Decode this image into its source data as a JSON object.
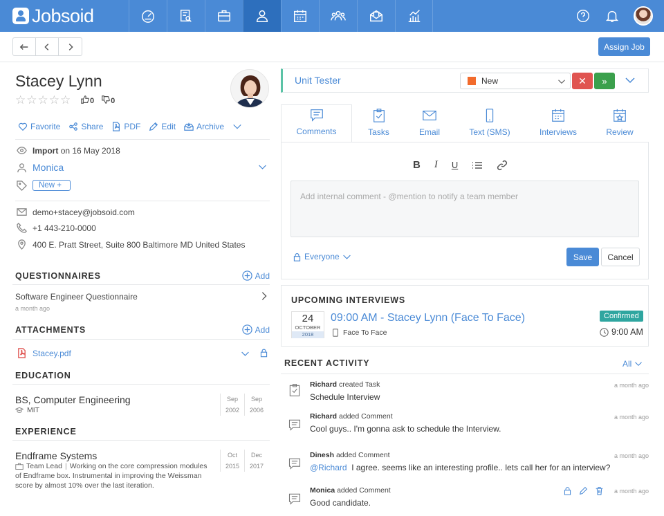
{
  "app": {
    "name": "Jobsoid"
  },
  "topnav": {
    "items": [
      {
        "icon": "dashboard-icon"
      },
      {
        "icon": "jobs-icon"
      },
      {
        "icon": "briefcase-icon"
      },
      {
        "icon": "candidates-icon",
        "active": true
      },
      {
        "icon": "calendar-icon"
      },
      {
        "icon": "team-icon"
      },
      {
        "icon": "mail-icon"
      },
      {
        "icon": "reports-icon"
      }
    ],
    "right": [
      "help-icon",
      "bell-icon",
      "user-avatar"
    ]
  },
  "toolbar": {
    "assign_label": "Assign Job"
  },
  "candidate": {
    "name": "Stacey Lynn",
    "rating": 0,
    "likes": "0",
    "dislikes": "0",
    "actions": {
      "favorite": "Favorite",
      "share": "Share",
      "pdf": "PDF",
      "edit": "Edit",
      "archive": "Archive"
    },
    "source_label": "Import",
    "source_date": "on 16 May 2018",
    "owner": "Monica",
    "tag": "New",
    "email": "demo+stacey@jobsoid.com",
    "phone": "+1 443-210-0000",
    "address": "400 E. Pratt Street, Suite 800 Baltimore MD United States"
  },
  "questionnaires": {
    "title": "QUESTIONNAIRES",
    "add": "Add",
    "items": [
      {
        "name": "Software Engineer Questionnaire",
        "when": "a month ago"
      }
    ]
  },
  "attachments": {
    "title": "ATTACHMENTS",
    "add": "Add",
    "items": [
      {
        "name": "Stacey.pdf"
      }
    ]
  },
  "education": {
    "title": "EDUCATION",
    "items": [
      {
        "degree": "BS, Computer Engineering",
        "school": "MIT",
        "from_m": "Sep",
        "from_y": "2002",
        "to_m": "Sep",
        "to_y": "2006"
      }
    ]
  },
  "experience": {
    "title": "EXPERIENCE",
    "items": [
      {
        "company": "Endframe Systems",
        "role": "Team Lead",
        "desc1": "Working on the core compression modules",
        "desc2": "of Endframe box. Instrumental in improving the Weissman",
        "desc3": "score by almost 10% over the last iteration.",
        "from_m": "Oct",
        "from_y": "2015",
        "to_m": "Dec",
        "to_y": "2017"
      }
    ]
  },
  "stage": {
    "job_title": "Unit Tester",
    "status": "New",
    "status_color": "#f26b2c"
  },
  "tabs": [
    "Comments",
    "Tasks",
    "Email",
    "Text (SMS)",
    "Interviews",
    "Review"
  ],
  "composer": {
    "placeholder": "Add internal comment - @mention to notify a team member",
    "visibility": "Everyone",
    "save": "Save",
    "cancel": "Cancel"
  },
  "interviews": {
    "title": "UPCOMING INTERVIEWS",
    "items": [
      {
        "day": "24",
        "month": "OCTOBER",
        "year": "2018",
        "title": "09:00 AM - Stacey Lynn (Face To Face)",
        "type": "Face To Face",
        "status": "Confirmed",
        "time": "9:00 AM"
      }
    ]
  },
  "activity": {
    "title": "RECENT ACTIVITY",
    "filter": "All",
    "items": [
      {
        "icon": "task-icon",
        "user": "Richard",
        "action": "created Task",
        "text": "Schedule Interview",
        "when": "a month ago"
      },
      {
        "icon": "comment-icon",
        "user": "Richard",
        "action": "added Comment",
        "text": "Cool guys.. I'm gonna ask to schedule the Interview.",
        "when": "a month ago"
      },
      {
        "icon": "comment-icon",
        "user": "Dinesh",
        "action": "added Comment",
        "mention": "@Richard",
        "text": "I agree. seems like an interesting profile.. lets call her for an interview?",
        "when": "a month ago"
      },
      {
        "icon": "comment-icon",
        "user": "Monica",
        "action": "added Comment",
        "text": "Good candidate.",
        "when": "a month ago"
      }
    ]
  },
  "colors": {
    "primary": "#4a8ad6",
    "nav_active": "#2d6fbd",
    "reject": "#e05450",
    "advance": "#3ba04c",
    "confirmed": "#2fa6a0",
    "stage_accent": "#5bc3a6"
  }
}
